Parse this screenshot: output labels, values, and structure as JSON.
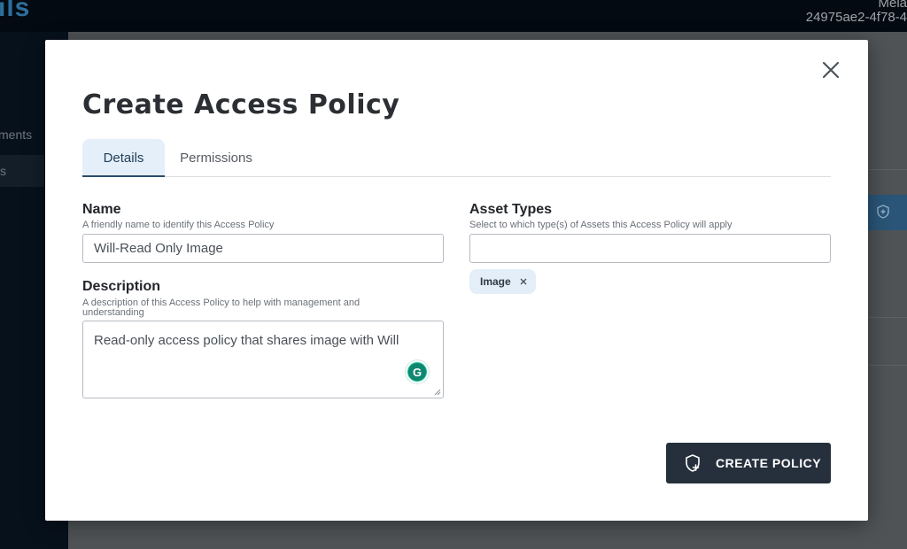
{
  "background": {
    "logo_text": "ils",
    "user_name": "Mela",
    "user_id": "24975ae2-4f78-4",
    "sidebar_items": [
      "ments",
      "s"
    ]
  },
  "modal": {
    "title": "Create Access Policy",
    "close_icon": "close-icon",
    "tabs": [
      {
        "label": "Details",
        "active": true
      },
      {
        "label": "Permissions",
        "active": false
      }
    ],
    "name_field": {
      "label": "Name",
      "hint": "A friendly name to identify this Access Policy",
      "value": "Will-Read Only Image"
    },
    "description_field": {
      "label": "Description",
      "hint": "A description of this Access Policy to help with management and understanding",
      "value": "Read-only access policy that shares image with Will"
    },
    "asset_types_field": {
      "label": "Asset Types",
      "hint": "Select to which type(s) of Assets this Access Policy will apply",
      "value": "",
      "selected_chips": [
        {
          "label": "Image",
          "remove_icon": "x-icon"
        }
      ]
    },
    "grammarly_label": "G",
    "create_button": {
      "label": "CREATE POLICY",
      "icon": "shield-plus-icon"
    }
  },
  "colors": {
    "primary_button": "#26303c",
    "active_tab_bg": "#e5eff9",
    "chip_bg": "#e3eef9",
    "grammarly": "#15c39a"
  }
}
